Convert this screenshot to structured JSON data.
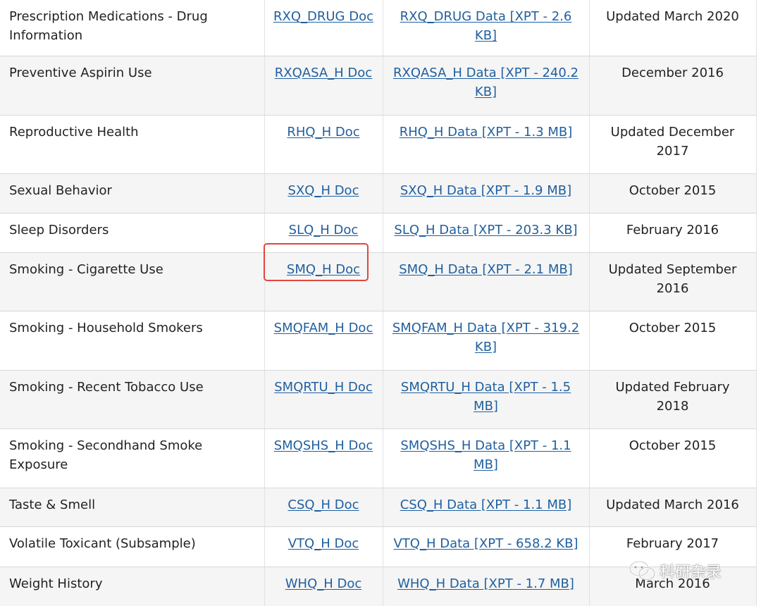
{
  "rows": [
    {
      "name": "Prescription Medications - Drug Information",
      "doc": "RXQ_DRUG Doc",
      "data": "RXQ_DRUG Data [XPT - 2.6 KB]",
      "date": "Updated March 2020"
    },
    {
      "name": "Preventive Aspirin Use",
      "doc": "RXQASA_H Doc",
      "data": "RXQASA_H Data [XPT - 240.2 KB]",
      "date": "December 2016"
    },
    {
      "name": "Reproductive Health",
      "doc": "RHQ_H Doc",
      "data": "RHQ_H Data [XPT - 1.3 MB]",
      "date": "Updated December 2017"
    },
    {
      "name": "Sexual Behavior",
      "doc": "SXQ_H Doc",
      "data": "SXQ_H Data [XPT - 1.9 MB]",
      "date": "October 2015"
    },
    {
      "name": "Sleep Disorders",
      "doc": "SLQ_H Doc",
      "data": "SLQ_H Data [XPT - 203.3 KB]",
      "date": "February 2016"
    },
    {
      "name": "Smoking - Cigarette Use",
      "doc": "SMQ_H Doc",
      "data": "SMQ_H Data [XPT - 2.1 MB]",
      "date": "Updated September 2016"
    },
    {
      "name": "Smoking - Household Smokers",
      "doc": "SMQFAM_H Doc",
      "data": "SMQFAM_H Data [XPT - 319.2 KB]",
      "date": "October 2015"
    },
    {
      "name": "Smoking - Recent Tobacco Use",
      "doc": "SMQRTU_H Doc",
      "data": "SMQRTU_H Data [XPT - 1.5 MB]",
      "date": "Updated February 2018"
    },
    {
      "name": "Smoking - Secondhand Smoke Exposure",
      "doc": "SMQSHS_H Doc",
      "data": "SMQSHS_H Data [XPT - 1.1 MB]",
      "date": "October 2015"
    },
    {
      "name": "Taste & Smell",
      "doc": "CSQ_H Doc",
      "data": "CSQ_H Data [XPT - 1.1 MB]",
      "date": "Updated March 2016"
    },
    {
      "name": "Volatile Toxicant (Subsample)",
      "doc": "VTQ_H Doc",
      "data": "VTQ_H Data [XPT - 658.2 KB]",
      "date": "February 2017"
    },
    {
      "name": "Weight History",
      "doc": "WHQ_H Doc",
      "data": "WHQ_H Data [XPT - 1.7 MB]",
      "date": "March 2016"
    }
  ],
  "watermark": {
    "text": "科研杂录",
    "icon": "wechat-icon"
  },
  "colors": {
    "link": "#1f5f9f",
    "highlight": "#e0463a",
    "row_alt": "#f5f5f5"
  }
}
